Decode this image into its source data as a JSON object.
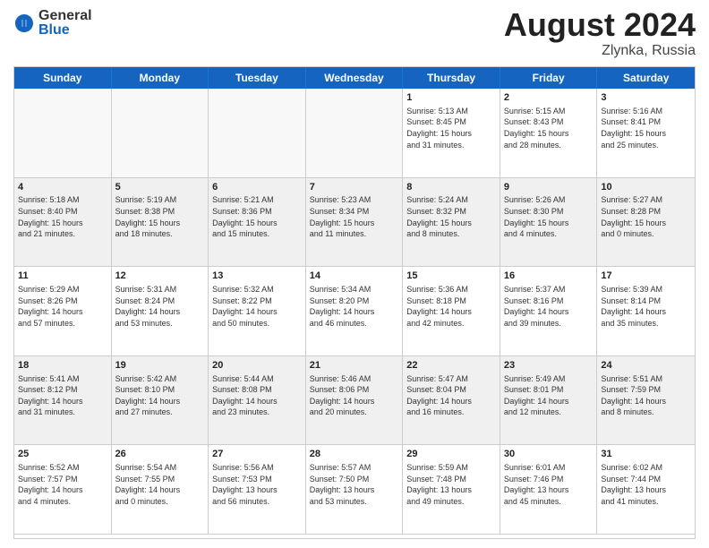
{
  "logo": {
    "general": "General",
    "blue": "Blue"
  },
  "title": {
    "month": "August 2024",
    "location": "Zlynka, Russia"
  },
  "weekdays": [
    "Sunday",
    "Monday",
    "Tuesday",
    "Wednesday",
    "Thursday",
    "Friday",
    "Saturday"
  ],
  "weeks": [
    [
      {
        "num": "",
        "info": "",
        "empty": true
      },
      {
        "num": "",
        "info": "",
        "empty": true
      },
      {
        "num": "",
        "info": "",
        "empty": true
      },
      {
        "num": "",
        "info": "",
        "empty": true
      },
      {
        "num": "1",
        "info": "Sunrise: 5:13 AM\nSunset: 8:45 PM\nDaylight: 15 hours\nand 31 minutes.",
        "empty": false
      },
      {
        "num": "2",
        "info": "Sunrise: 5:15 AM\nSunset: 8:43 PM\nDaylight: 15 hours\nand 28 minutes.",
        "empty": false
      },
      {
        "num": "3",
        "info": "Sunrise: 5:16 AM\nSunset: 8:41 PM\nDaylight: 15 hours\nand 25 minutes.",
        "empty": false
      }
    ],
    [
      {
        "num": "4",
        "info": "Sunrise: 5:18 AM\nSunset: 8:40 PM\nDaylight: 15 hours\nand 21 minutes.",
        "empty": false
      },
      {
        "num": "5",
        "info": "Sunrise: 5:19 AM\nSunset: 8:38 PM\nDaylight: 15 hours\nand 18 minutes.",
        "empty": false
      },
      {
        "num": "6",
        "info": "Sunrise: 5:21 AM\nSunset: 8:36 PM\nDaylight: 15 hours\nand 15 minutes.",
        "empty": false
      },
      {
        "num": "7",
        "info": "Sunrise: 5:23 AM\nSunset: 8:34 PM\nDaylight: 15 hours\nand 11 minutes.",
        "empty": false
      },
      {
        "num": "8",
        "info": "Sunrise: 5:24 AM\nSunset: 8:32 PM\nDaylight: 15 hours\nand 8 minutes.",
        "empty": false
      },
      {
        "num": "9",
        "info": "Sunrise: 5:26 AM\nSunset: 8:30 PM\nDaylight: 15 hours\nand 4 minutes.",
        "empty": false
      },
      {
        "num": "10",
        "info": "Sunrise: 5:27 AM\nSunset: 8:28 PM\nDaylight: 15 hours\nand 0 minutes.",
        "empty": false
      }
    ],
    [
      {
        "num": "11",
        "info": "Sunrise: 5:29 AM\nSunset: 8:26 PM\nDaylight: 14 hours\nand 57 minutes.",
        "empty": false
      },
      {
        "num": "12",
        "info": "Sunrise: 5:31 AM\nSunset: 8:24 PM\nDaylight: 14 hours\nand 53 minutes.",
        "empty": false
      },
      {
        "num": "13",
        "info": "Sunrise: 5:32 AM\nSunset: 8:22 PM\nDaylight: 14 hours\nand 50 minutes.",
        "empty": false
      },
      {
        "num": "14",
        "info": "Sunrise: 5:34 AM\nSunset: 8:20 PM\nDaylight: 14 hours\nand 46 minutes.",
        "empty": false
      },
      {
        "num": "15",
        "info": "Sunrise: 5:36 AM\nSunset: 8:18 PM\nDaylight: 14 hours\nand 42 minutes.",
        "empty": false
      },
      {
        "num": "16",
        "info": "Sunrise: 5:37 AM\nSunset: 8:16 PM\nDaylight: 14 hours\nand 39 minutes.",
        "empty": false
      },
      {
        "num": "17",
        "info": "Sunrise: 5:39 AM\nSunset: 8:14 PM\nDaylight: 14 hours\nand 35 minutes.",
        "empty": false
      }
    ],
    [
      {
        "num": "18",
        "info": "Sunrise: 5:41 AM\nSunset: 8:12 PM\nDaylight: 14 hours\nand 31 minutes.",
        "empty": false
      },
      {
        "num": "19",
        "info": "Sunrise: 5:42 AM\nSunset: 8:10 PM\nDaylight: 14 hours\nand 27 minutes.",
        "empty": false
      },
      {
        "num": "20",
        "info": "Sunrise: 5:44 AM\nSunset: 8:08 PM\nDaylight: 14 hours\nand 23 minutes.",
        "empty": false
      },
      {
        "num": "21",
        "info": "Sunrise: 5:46 AM\nSunset: 8:06 PM\nDaylight: 14 hours\nand 20 minutes.",
        "empty": false
      },
      {
        "num": "22",
        "info": "Sunrise: 5:47 AM\nSunset: 8:04 PM\nDaylight: 14 hours\nand 16 minutes.",
        "empty": false
      },
      {
        "num": "23",
        "info": "Sunrise: 5:49 AM\nSunset: 8:01 PM\nDaylight: 14 hours\nand 12 minutes.",
        "empty": false
      },
      {
        "num": "24",
        "info": "Sunrise: 5:51 AM\nSunset: 7:59 PM\nDaylight: 14 hours\nand 8 minutes.",
        "empty": false
      }
    ],
    [
      {
        "num": "25",
        "info": "Sunrise: 5:52 AM\nSunset: 7:57 PM\nDaylight: 14 hours\nand 4 minutes.",
        "empty": false
      },
      {
        "num": "26",
        "info": "Sunrise: 5:54 AM\nSunset: 7:55 PM\nDaylight: 14 hours\nand 0 minutes.",
        "empty": false
      },
      {
        "num": "27",
        "info": "Sunrise: 5:56 AM\nSunset: 7:53 PM\nDaylight: 13 hours\nand 56 minutes.",
        "empty": false
      },
      {
        "num": "28",
        "info": "Sunrise: 5:57 AM\nSunset: 7:50 PM\nDaylight: 13 hours\nand 53 minutes.",
        "empty": false
      },
      {
        "num": "29",
        "info": "Sunrise: 5:59 AM\nSunset: 7:48 PM\nDaylight: 13 hours\nand 49 minutes.",
        "empty": false
      },
      {
        "num": "30",
        "info": "Sunrise: 6:01 AM\nSunset: 7:46 PM\nDaylight: 13 hours\nand 45 minutes.",
        "empty": false
      },
      {
        "num": "31",
        "info": "Sunrise: 6:02 AM\nSunset: 7:44 PM\nDaylight: 13 hours\nand 41 minutes.",
        "empty": false
      }
    ]
  ]
}
